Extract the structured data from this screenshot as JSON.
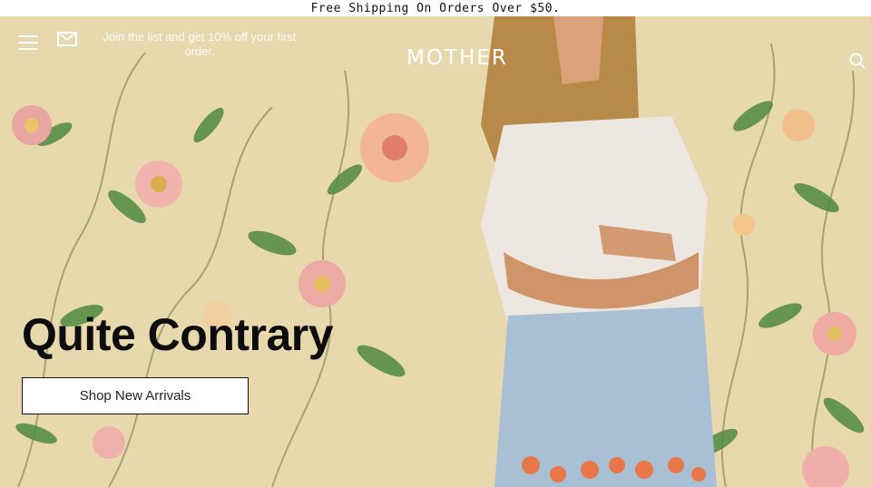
{
  "promo_bar": {
    "text": "Free Shipping On Orders Over $50."
  },
  "header": {
    "menu_icon": "hamburger-menu-icon",
    "mail_icon": "envelope-icon",
    "newsletter_text": "Join the list and get 10% off your first order.",
    "logo": "MOTHER",
    "search_icon": "search-icon"
  },
  "hero": {
    "headline": "Quite Contrary",
    "cta_label": "Shop New Arrivals"
  },
  "colors": {
    "wallpaper": "#e6d6a8",
    "text_dark": "#0d0d0d",
    "white": "#ffffff"
  }
}
